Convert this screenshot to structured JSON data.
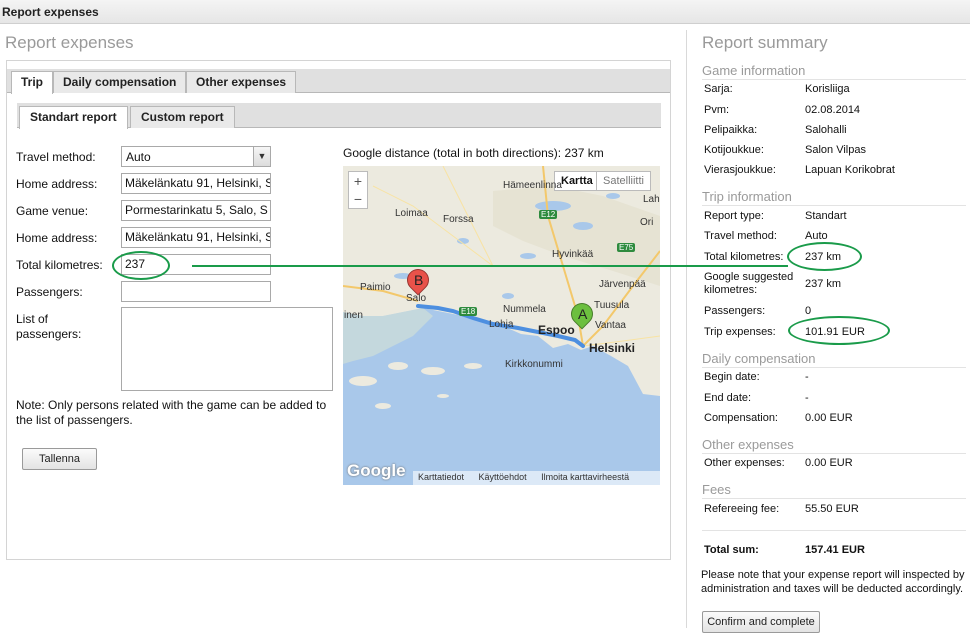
{
  "window": {
    "title": "Report expenses"
  },
  "left_panel": {
    "title": "Report expenses",
    "tabs": [
      "Trip",
      "Daily compensation",
      "Other expenses"
    ],
    "subtabs": [
      "Standart report",
      "Custom report"
    ],
    "form": {
      "travel_method_label": "Travel method:",
      "travel_method_value": "Auto",
      "home_address_label": "Home address:",
      "home_address_value": "Mäkelänkatu 91, Helsinki, S",
      "game_venue_label": "Game venue:",
      "game_venue_value": "Pormestarinkatu 5, Salo, S",
      "home_address2_label": "Home address:",
      "home_address2_value": "Mäkelänkatu 91, Helsinki, S",
      "total_km_label": "Total kilometres:",
      "total_km_value": "237",
      "passengers_label": "Passengers:",
      "passengers_value": "",
      "list_label": "List of passengers:",
      "note": "Note: Only persons related with the game can be added to the list of passengers.",
      "save_button": "Tallenna"
    },
    "map": {
      "distance_text": "Google distance (total in both directions): 237 km",
      "zoom_in": "+",
      "zoom_out": "−",
      "type_map": "Kartta",
      "type_satellite": "Satelliitti",
      "logo": "Google",
      "attributions": [
        "Karttatiedot",
        "Käyttöehdot",
        "Ilmoita karttavirheestä"
      ],
      "marker_a": "A",
      "marker_b": "B",
      "labels": {
        "hameenlinna": "Hämeenlinna",
        "lahti": "Lah",
        "loimaa": "Loimaa",
        "forssa": "Forssa",
        "ori": "Ori",
        "hyvinkaa": "Hyvinkää",
        "jarvenpaa": "Järvenpää",
        "paimio": "Paimio",
        "salo": "Salo",
        "tuusula": "Tuusula",
        "nummela": "Nummela",
        "lohja": "Lohja",
        "espoo": "Espoo",
        "vantaa": "Vantaa",
        "helsinki": "Helsinki",
        "inen": "inen",
        "kirkkonummi": "Kirkkonummi",
        "e12": "E12",
        "e75": "E75",
        "e18": "E18"
      }
    }
  },
  "summary": {
    "title": "Report summary",
    "game_info": {
      "heading": "Game information",
      "rows": [
        {
          "label": "Sarja:",
          "value": "Korisliiga"
        },
        {
          "label": "Pvm:",
          "value": "02.08.2014"
        },
        {
          "label": "Pelipaikka:",
          "value": "Salohalli"
        },
        {
          "label": "Kotijoukkue:",
          "value": "Salon Vilpas"
        },
        {
          "label": "Vierasjoukkue:",
          "value": "Lapuan Korikobrat"
        }
      ]
    },
    "trip_info": {
      "heading": "Trip information",
      "rows": [
        {
          "label": "Report type:",
          "value": "Standart"
        },
        {
          "label": "Travel method:",
          "value": "Auto"
        },
        {
          "label": "Total kilometres:",
          "value": "237 km"
        },
        {
          "label": "Google suggested kilometres:",
          "value": "237 km"
        },
        {
          "label": "Passengers:",
          "value": "0"
        },
        {
          "label": "Trip expenses:",
          "value": "101.91 EUR"
        }
      ]
    },
    "daily_comp": {
      "heading": "Daily compensation",
      "rows": [
        {
          "label": "Begin date:",
          "value": "-"
        },
        {
          "label": "End date:",
          "value": "-"
        },
        {
          "label": "Compensation:",
          "value": "0.00 EUR"
        }
      ]
    },
    "other": {
      "heading": "Other expenses",
      "rows": [
        {
          "label": "Other expenses:",
          "value": "0.00 EUR"
        }
      ]
    },
    "fees": {
      "heading": "Fees",
      "rows": [
        {
          "label": "Refereeing fee:",
          "value": "55.50 EUR"
        }
      ]
    },
    "total": {
      "label": "Total sum:",
      "value": "157.41 EUR"
    },
    "note": "Please note that your expense report will inspected by administration and taxes will be deducted accordingly.",
    "confirm_button": "Confirm and complete"
  },
  "colors": {
    "annotation": "#1a9b4a",
    "water": "#a9c8ea",
    "land": "#eceadf",
    "route": "#4d8fe0"
  }
}
